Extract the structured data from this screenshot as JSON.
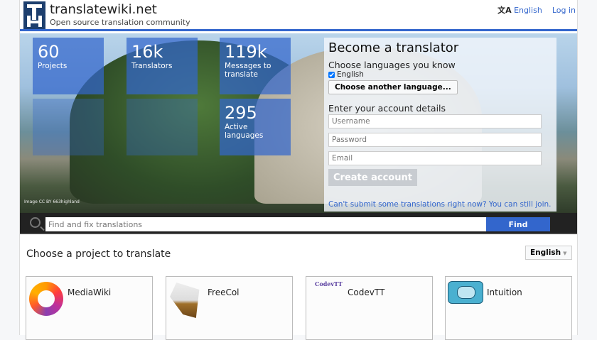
{
  "header": {
    "title": "translatewiki.net",
    "tagline": "Open source translation community",
    "language_link": "English",
    "login_link": "Log in"
  },
  "stats": [
    {
      "number": "60",
      "label": "Projects"
    },
    {
      "number": "16k",
      "label": "Translators"
    },
    {
      "number": "119k",
      "label": "Messages to translate"
    },
    {
      "number": "295",
      "label": "Active languages"
    }
  ],
  "image_credit": "Image CC BY 663highland",
  "signup": {
    "title": "Become a translator",
    "languages_heading": "Choose languages you know",
    "checked_language": "English",
    "choose_language_button": "Choose another language...",
    "account_heading": "Enter your account details",
    "username_placeholder": "Username",
    "password_placeholder": "Password",
    "email_placeholder": "Email",
    "create_button": "Create account",
    "join_link": "Can't submit some translations right now? You can still join."
  },
  "search": {
    "placeholder": "Find and fix translations",
    "button": "Find"
  },
  "projects": {
    "heading": "Choose a project to translate",
    "language": "English",
    "items": [
      {
        "name": "MediaWiki"
      },
      {
        "name": "FreeCol"
      },
      {
        "name": "CodevTT",
        "logo_text": "CodevTT"
      },
      {
        "name": "Intuition"
      }
    ]
  }
}
